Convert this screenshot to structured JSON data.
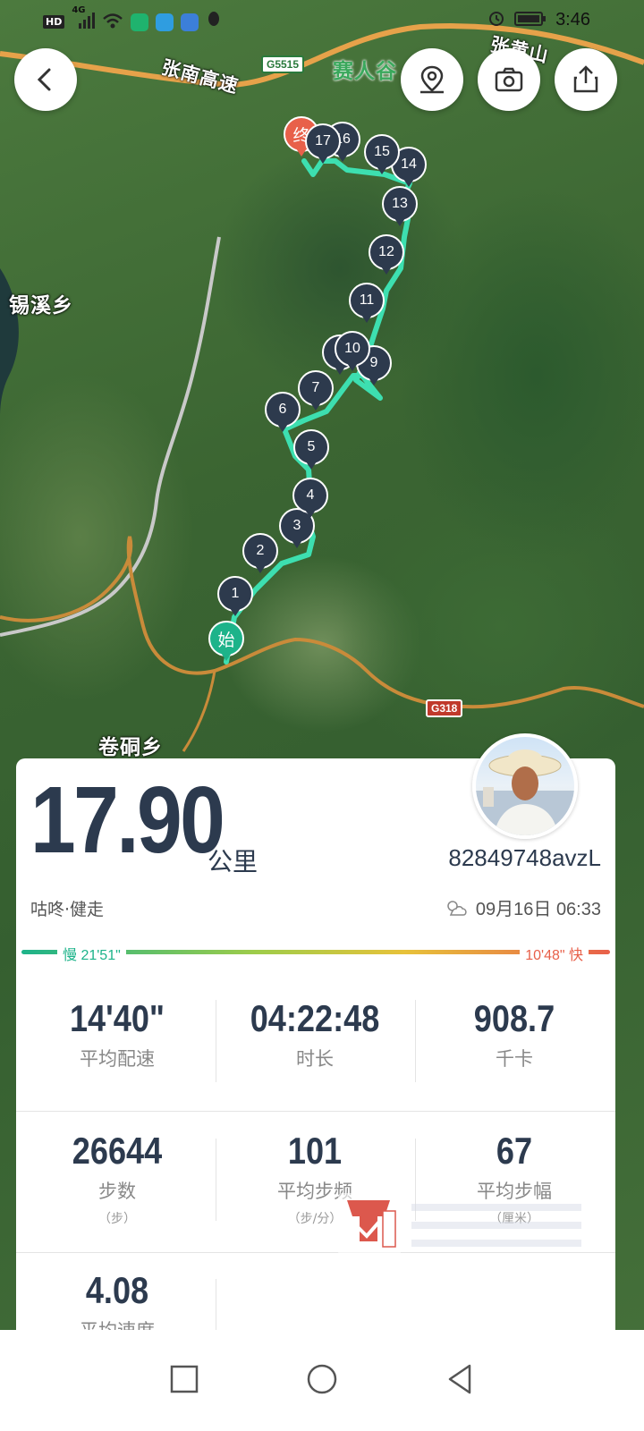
{
  "status_bar": {
    "time": "3:46",
    "network": "HD",
    "signal": "4G"
  },
  "map": {
    "place_labels": [
      "锡溪乡",
      "卷硐乡",
      "赛人谷"
    ],
    "highway_label": "张南高速",
    "highway_badge": "G5515",
    "region_label_right": "张黄山",
    "national_road_badge": "G318",
    "start_marker": "始",
    "end_marker": "终",
    "km_markers": [
      "1",
      "2",
      "3",
      "4",
      "5",
      "6",
      "7",
      "8",
      "9",
      "10",
      "11",
      "12",
      "13",
      "14",
      "15",
      "16",
      "17"
    ]
  },
  "card": {
    "distance_value": "17.90",
    "distance_unit": "公里",
    "user_id": "82849748avzL",
    "activity_type": "咕咚·健走",
    "date": "09月16日 06:33",
    "pace_slow": "慢 21'51\"",
    "pace_fast": "10'48\" 快",
    "stats_row1": [
      {
        "value": "14'40\"",
        "label": "平均配速"
      },
      {
        "value": "04:22:48",
        "label": "时长"
      },
      {
        "value": "908.7",
        "label": "千卡"
      }
    ],
    "stats_row2": [
      {
        "value": "26644",
        "label": "步数",
        "unit": "（步）"
      },
      {
        "value": "101",
        "label": "平均步频",
        "unit": "（步/分）"
      },
      {
        "value": "67",
        "label": "平均步幅",
        "unit": "（厘米）"
      }
    ],
    "stats_row3": [
      {
        "value": "4.08",
        "label": "平均速度"
      }
    ]
  },
  "colors": {
    "accent": "#1db38a",
    "end": "#e8604a",
    "marker": "#2d3a4d",
    "text": "#2c3a4e"
  },
  "icons": {
    "back": "chevron-left-icon",
    "location": "map-pin-icon",
    "camera": "camera-icon",
    "share": "share-icon",
    "weather": "partly-cloudy-icon",
    "nav_recent": "square-icon",
    "nav_home": "circle-icon",
    "nav_back": "triangle-back-icon"
  }
}
